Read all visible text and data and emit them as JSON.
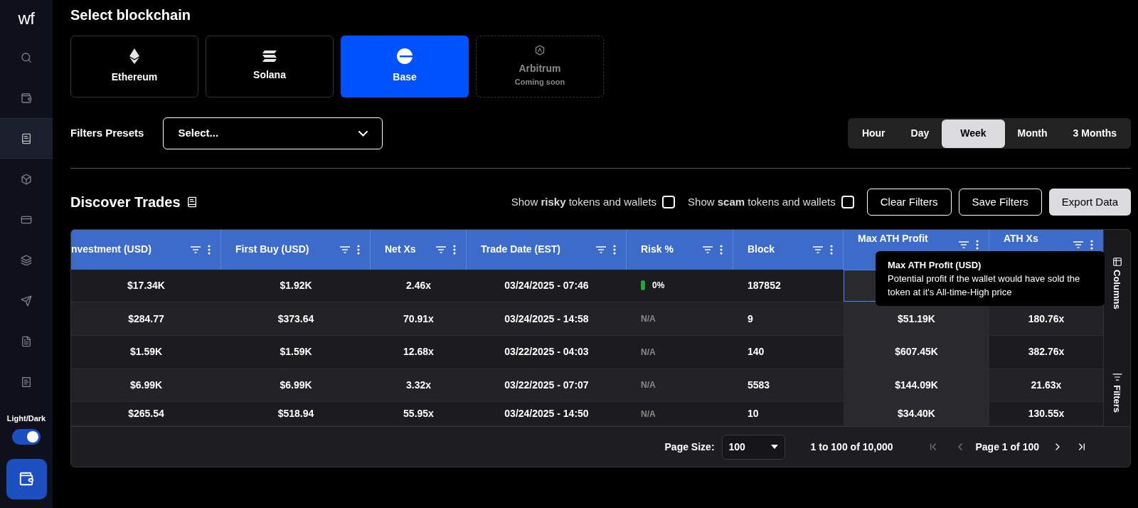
{
  "sidebar": {
    "logo": "wf",
    "items": [
      {
        "kind": "search",
        "selected": false
      },
      {
        "kind": "wallet",
        "selected": false
      },
      {
        "kind": "book",
        "selected": true
      },
      {
        "kind": "cube",
        "selected": false
      },
      {
        "kind": "card",
        "selected": false
      },
      {
        "kind": "stack",
        "selected": false
      },
      {
        "kind": "send",
        "selected": false
      },
      {
        "kind": "file",
        "selected": false
      },
      {
        "kind": "receipt",
        "selected": false
      }
    ],
    "theme_label": "Light/Dark",
    "theme_on": true
  },
  "title": "Select blockchain",
  "chains": [
    {
      "kind": "ethereum",
      "label": "Ethereum",
      "selected": false,
      "disabled": false
    },
    {
      "kind": "solana",
      "label": "Solana",
      "selected": false,
      "disabled": false
    },
    {
      "kind": "base",
      "label": "Base",
      "selected": true,
      "disabled": false
    },
    {
      "kind": "arbitrum",
      "label": "Arbitrum",
      "note": "Coming soon",
      "selected": false,
      "disabled": true
    }
  ],
  "presets": {
    "label": "Filters Presets",
    "value": "Select..."
  },
  "ranges": [
    {
      "label": "Hour",
      "selected": false
    },
    {
      "label": "Day",
      "selected": false
    },
    {
      "label": "Week",
      "selected": true
    },
    {
      "label": "Month",
      "selected": false
    },
    {
      "label": "3 Months",
      "selected": false
    }
  ],
  "section_title": "Discover Trades",
  "toggles": [
    {
      "label": "Show **risky** tokens and wallets",
      "checked": false
    },
    {
      "label": "Show **scam** tokens and wallets",
      "checked": false
    }
  ],
  "buttons": [
    {
      "label": "Clear Filters",
      "kind": "outline"
    },
    {
      "label": "Save Filters",
      "kind": "outline"
    },
    {
      "label": "Export Data",
      "kind": "solid"
    }
  ],
  "table": {
    "columns": [
      "nvestment (USD)",
      "First Buy (USD)",
      "Net Xs",
      "Trade Date (EST)",
      "Risk %",
      "Block",
      "Max ATH Profit",
      "ATH Xs"
    ],
    "rows": [
      {
        "cells": [
          "$17.34K",
          "$1.92K",
          "2.46x",
          "03/24/2025 - 07:46",
          "0%",
          "187852"
        ],
        "color": "#22a83a",
        "focused": true
      },
      {
        "cells": [
          "$284.77",
          "$373.64",
          "70.91x",
          "03/24/2025 - 14:58",
          "N/A",
          "9",
          "$51.19K",
          "180.76x"
        ],
        "focused": false
      },
      {
        "cells": [
          "$1.59K",
          "$1.59K",
          "12.68x",
          "03/22/2025 - 04:03",
          "N/A",
          "140",
          "$607.45K",
          "382.76x"
        ],
        "focused": false
      },
      {
        "cells": [
          "$6.99K",
          "$6.99K",
          "3.32x",
          "03/22/2025 - 07:07",
          "N/A",
          "5583",
          "$144.09K",
          "21.63x"
        ],
        "focused": false
      },
      {
        "cells": [
          "$265.54",
          "$518.94",
          "55.95x",
          "03/24/2025 - 14:50",
          "N/A",
          "10",
          "$34.40K",
          "130.55x"
        ],
        "focused": false
      }
    ],
    "side_tabs": [
      "Columns",
      "Filters"
    ],
    "tooltip": {
      "title": "Max ATH Profit (USD)",
      "text": "Potential profit if the wallet would have sold the token at it's All-time-High price"
    },
    "footer": {
      "page_size_label": "Page Size:",
      "page_size": "100",
      "range": "1 to 100 of 10,000",
      "page": "Page 1 of 100"
    }
  }
}
